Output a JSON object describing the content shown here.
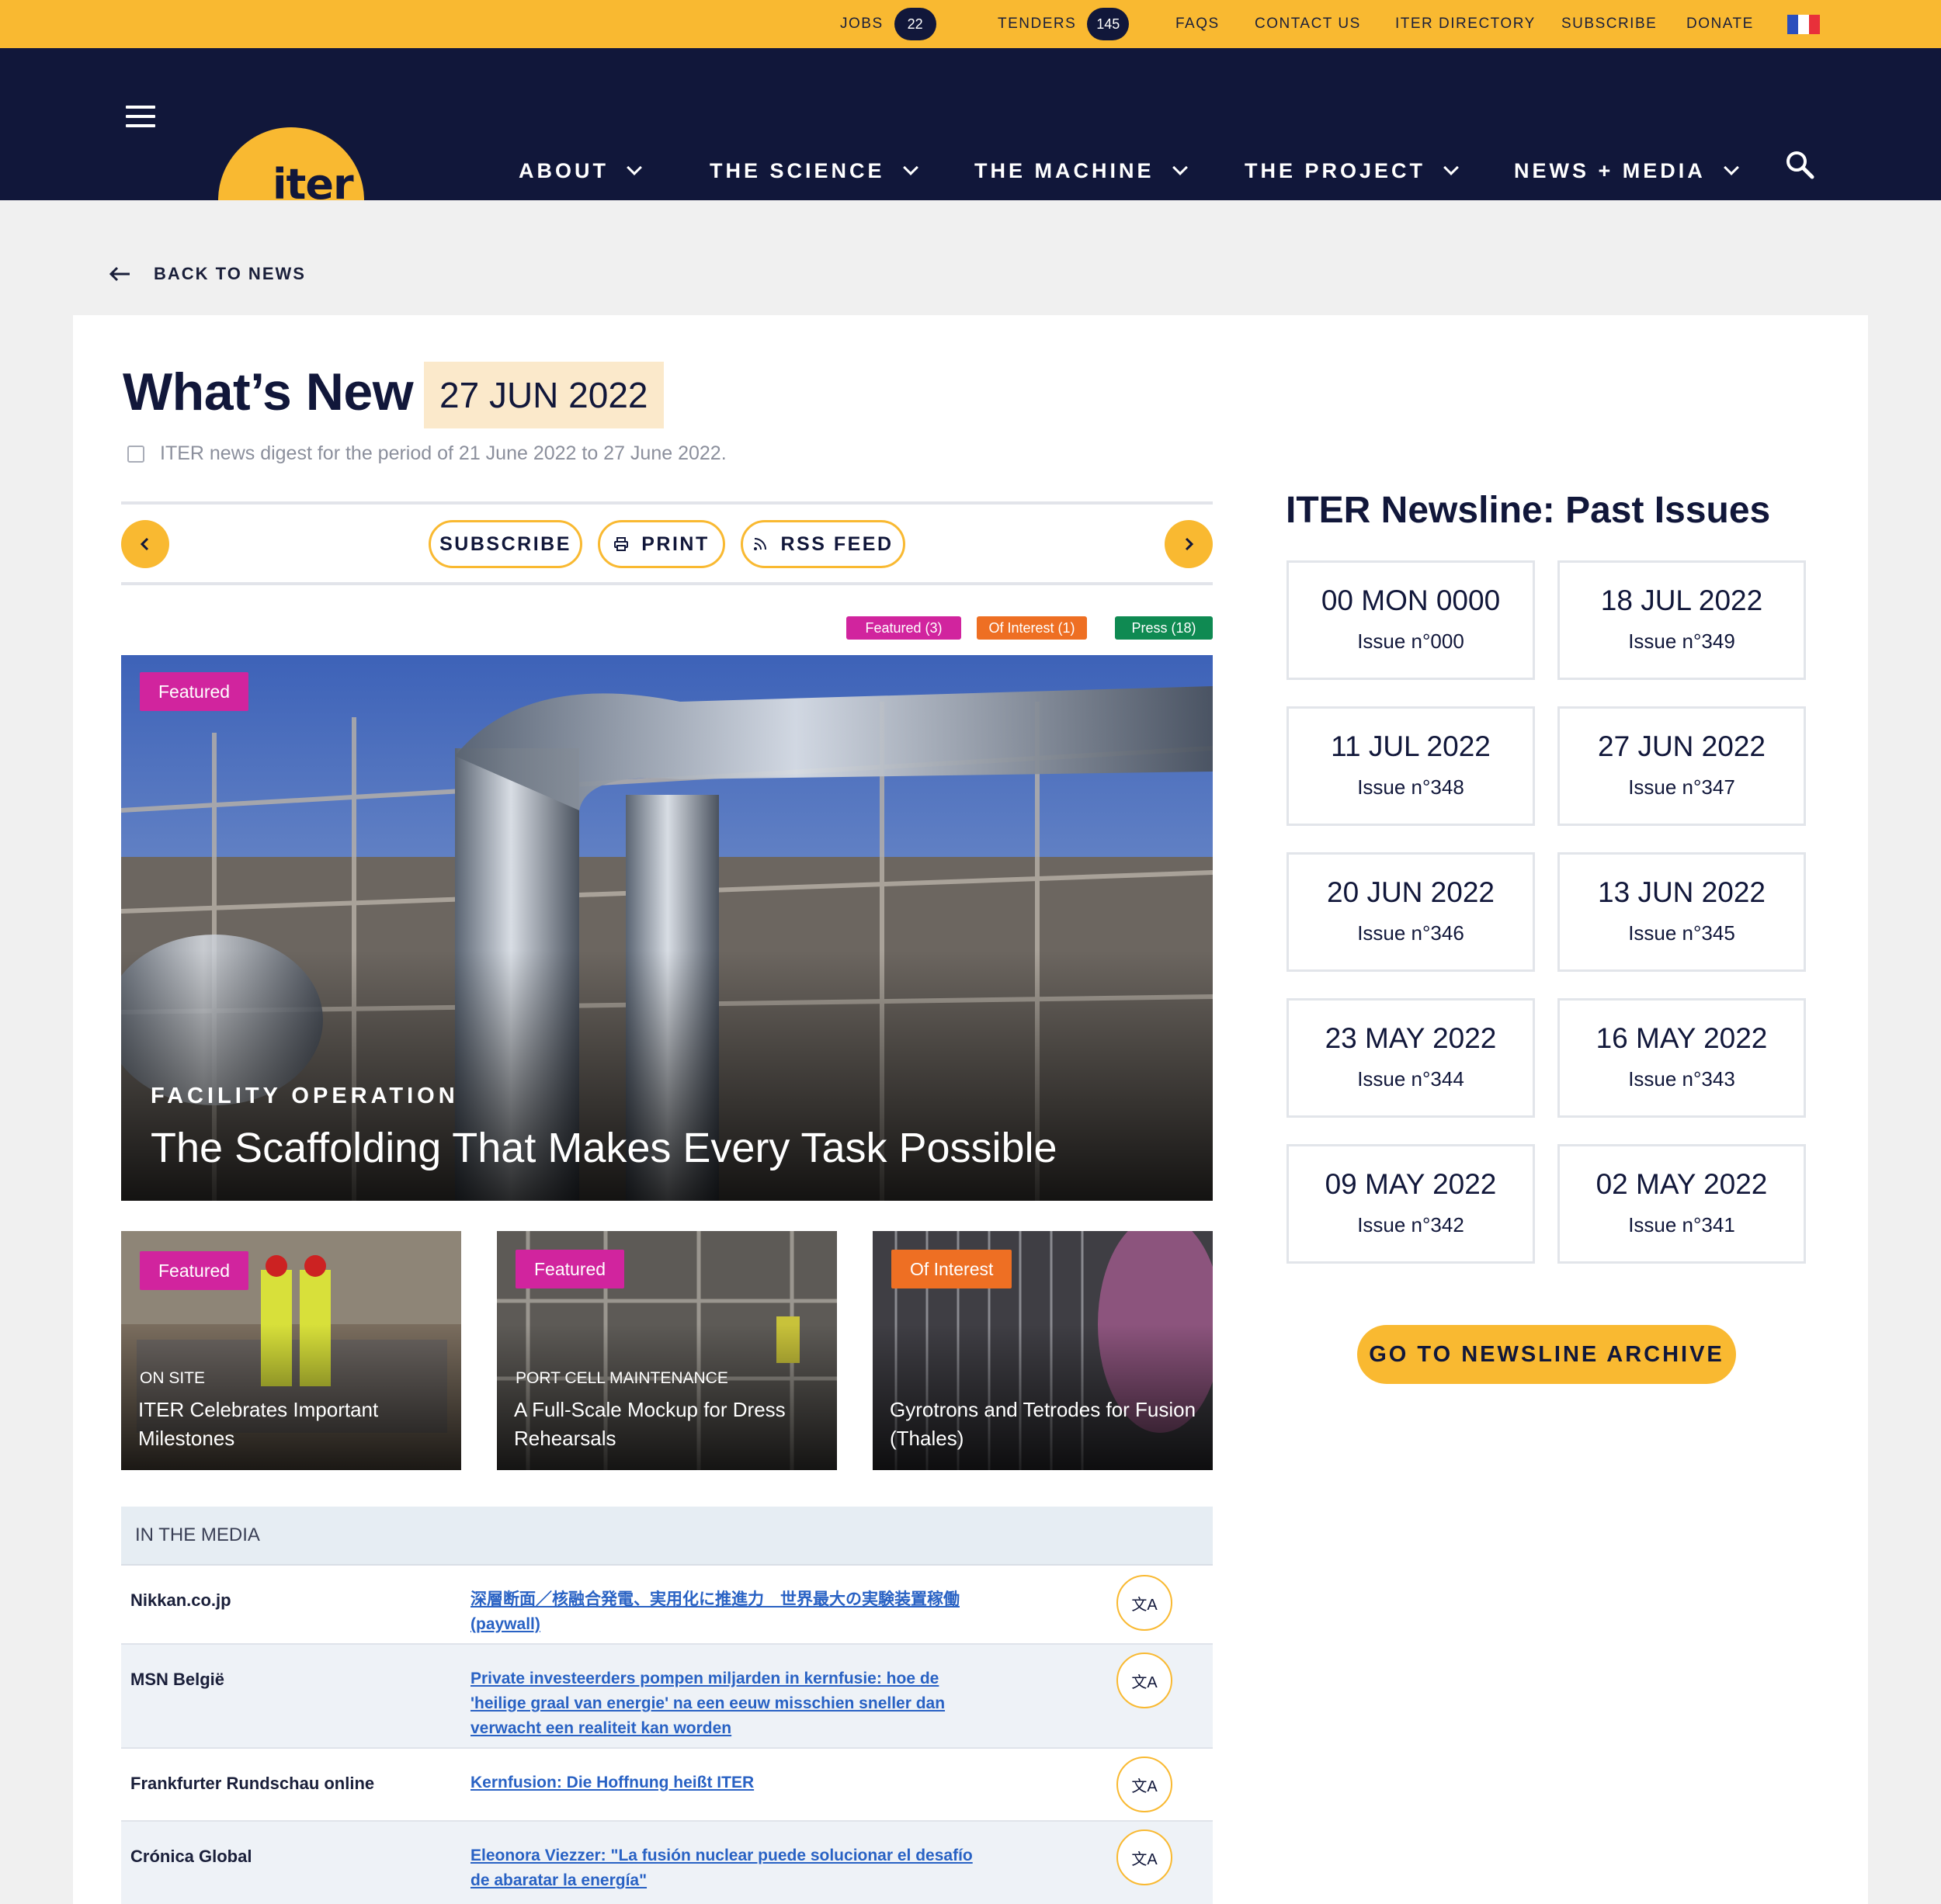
{
  "topbar": {
    "jobs_label": "Jobs",
    "jobs_count": "22",
    "tenders_label": "Tenders",
    "tenders_count": "145",
    "faqs": "FAQs",
    "contact": "Contact us",
    "directory": "ITER Directory",
    "subscribe": "Subscribe",
    "donate": "Donate",
    "colors": {
      "accent": "#f9b931",
      "navy": "#11173a"
    }
  },
  "nav": {
    "logo_text": "iter",
    "items": [
      "About",
      "The Science",
      "The Machine",
      "The Project",
      "News + Media"
    ],
    "icons": [
      "menu-icon",
      "search-icon",
      "chevron-down-icon"
    ]
  },
  "back_label": "Back to news",
  "header": {
    "title": "What’s New",
    "date": "27 JUN 2022",
    "digest": "ITER news digest for the period of 21 June 2022 to 27 June 2022."
  },
  "toolbar": {
    "subscribe": "Subscribe",
    "print": "Print",
    "rss": "RSS Feed"
  },
  "categories": [
    {
      "label": "Featured (3)",
      "color": "#d1249e"
    },
    {
      "label": "Of Interest (1)",
      "color": "#ee6f23"
    },
    {
      "label": "Press (18)",
      "color": "#0f8a52"
    }
  ],
  "hero": {
    "badge": "Featured",
    "kicker": "Facility operation",
    "title": "The Scaffolding That Makes Every Task Possible"
  },
  "thumbs": [
    {
      "badge": "Featured",
      "kicker": "On site",
      "title": "ITER Celebrates Important Milestones"
    },
    {
      "badge": "Featured",
      "kicker": "Port cell maintenance",
      "title": "A Full-Scale Mockup for Dress Rehearsals"
    },
    {
      "badge": "Of Interest",
      "kicker": "",
      "title": "Gyrotrons and Tetrodes for Fusion (Thales)"
    }
  ],
  "media": {
    "heading": "In the media",
    "rows": [
      {
        "source": "Nikkan.co.jp",
        "title": "深層断面／核融合発電、実用化に推進力　世界最大の実験装置稼働 (paywall)"
      },
      {
        "source": "MSN België",
        "title": "Private investeerders pompen miljarden in kernfusie: hoe de 'heilige graal van energie' na een eeuw misschien sneller dan verwacht een realiteit kan worden"
      },
      {
        "source": "Frankfurter Rundschau online",
        "title": "Kernfusion: Die Hoffnung heißt ITER"
      },
      {
        "source": "Crónica Global",
        "title": "Eleonora Viezzer: \"La fusión nuclear puede solucionar el desafío de abaratar la energía\""
      }
    ]
  },
  "past_issues": {
    "title": "ITER Newsline: Past Issues",
    "items": [
      {
        "date": "00 MON 0000",
        "issue": "Issue n°000"
      },
      {
        "date": "18 JUL 2022",
        "issue": "Issue n°349"
      },
      {
        "date": "11 JUL 2022",
        "issue": "Issue n°348"
      },
      {
        "date": "27 JUN 2022",
        "issue": "Issue n°347"
      },
      {
        "date": "20 JUN 2022",
        "issue": "Issue n°346"
      },
      {
        "date": "13 JUN 2022",
        "issue": "Issue n°345"
      },
      {
        "date": "23 MAY 2022",
        "issue": "Issue n°344"
      },
      {
        "date": "16 MAY 2022",
        "issue": "Issue n°343"
      },
      {
        "date": "09 MAY 2022",
        "issue": "Issue n°342"
      },
      {
        "date": "02 MAY 2022",
        "issue": "Issue n°341"
      }
    ],
    "archive_button": "Go to Newsline archive"
  }
}
